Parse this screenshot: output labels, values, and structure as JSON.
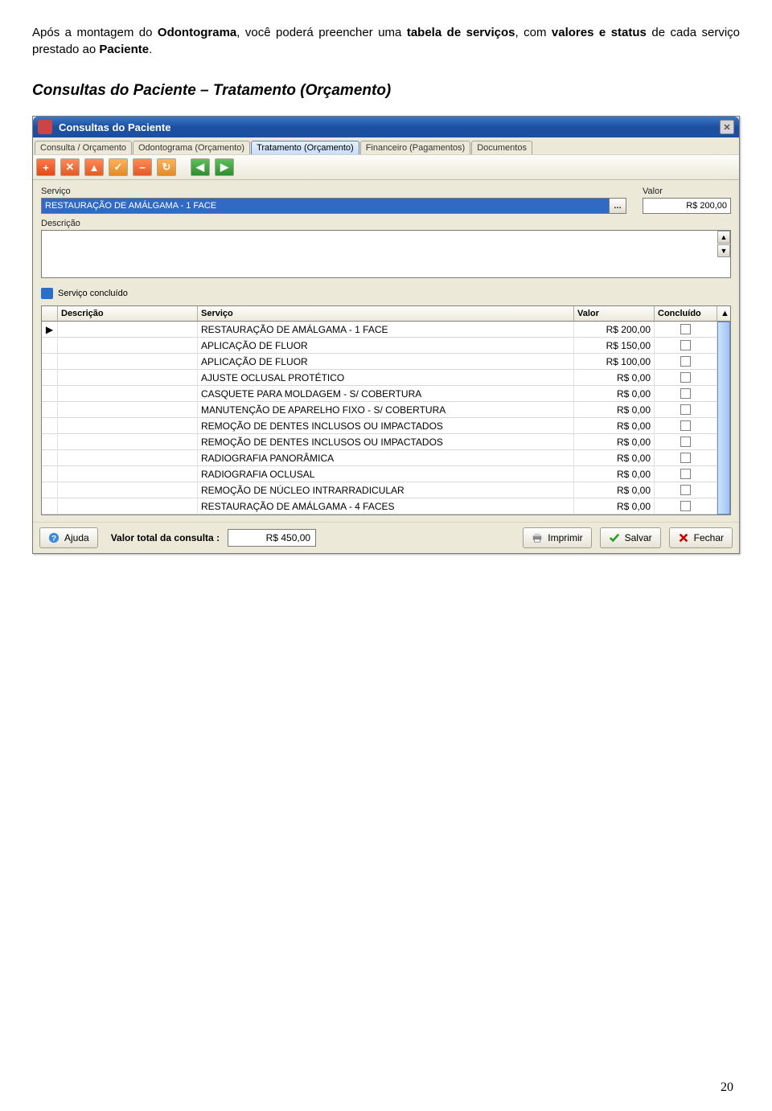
{
  "doc": {
    "intro_html": "Após a montagem do <b>Odontograma</b>, você poderá preencher uma <b>tabela de serviços</b>, com <b>valores e status</b> de cada serviço prestado ao <b>Paciente</b>.",
    "heading": "Consultas do Paciente – Tratamento (Orçamento)",
    "page_number": "20"
  },
  "window": {
    "title": "Consultas do Paciente",
    "tabs": [
      {
        "label": "Consulta / Orçamento",
        "active": false
      },
      {
        "label": "Odontograma (Orçamento)",
        "active": false
      },
      {
        "label": "Tratamento (Orçamento)",
        "active": true
      },
      {
        "label": "Financeiro (Pagamentos)",
        "active": false
      },
      {
        "label": "Documentos",
        "active": false
      }
    ],
    "form": {
      "servico_label": "Serviço",
      "servico_value": "RESTAURAÇÃO DE AMÁLGAMA - 1 FACE",
      "combo_button": "…",
      "valor_label": "Valor",
      "valor_value": "R$ 200,00",
      "descricao_label": "Descrição",
      "servico_concluido_label": "Serviço concluído"
    },
    "grid": {
      "headers": {
        "descricao": "Descrição",
        "servico": "Serviço",
        "valor": "Valor",
        "concluido": "Concluído"
      },
      "rows": [
        {
          "servico": "RESTAURAÇÃO DE AMÁLGAMA - 1 FACE",
          "valor": "R$ 200,00"
        },
        {
          "servico": "APLICAÇÃO DE FLUOR",
          "valor": "R$ 150,00"
        },
        {
          "servico": "APLICAÇÃO DE FLUOR",
          "valor": "R$ 100,00"
        },
        {
          "servico": "AJUSTE OCLUSAL PROTÉTICO",
          "valor": "R$ 0,00"
        },
        {
          "servico": "CASQUETE PARA MOLDAGEM - S/ COBERTURA",
          "valor": "R$ 0,00"
        },
        {
          "servico": "MANUTENÇÃO DE APARELHO FIXO - S/ COBERTURA",
          "valor": "R$ 0,00"
        },
        {
          "servico": "REMOÇÃO DE DENTES INCLUSOS OU IMPACTADOS",
          "valor": "R$ 0,00"
        },
        {
          "servico": "REMOÇÃO DE DENTES INCLUSOS OU IMPACTADOS",
          "valor": "R$ 0,00"
        },
        {
          "servico": "RADIOGRAFIA PANORÂMICA",
          "valor": "R$ 0,00"
        },
        {
          "servico": "RADIOGRAFIA OCLUSAL",
          "valor": "R$ 0,00"
        },
        {
          "servico": "REMOÇÃO DE NÚCLEO INTRARRADICULAR",
          "valor": "R$ 0,00"
        },
        {
          "servico": "RESTAURAÇÃO DE AMÁLGAMA - 4 FACES",
          "valor": "R$ 0,00"
        }
      ]
    },
    "footer": {
      "ajuda": "Ajuda",
      "total_label": "Valor total da consulta :",
      "total_value": "R$ 450,00",
      "imprimir": "Imprimir",
      "salvar": "Salvar",
      "fechar": "Fechar"
    }
  }
}
